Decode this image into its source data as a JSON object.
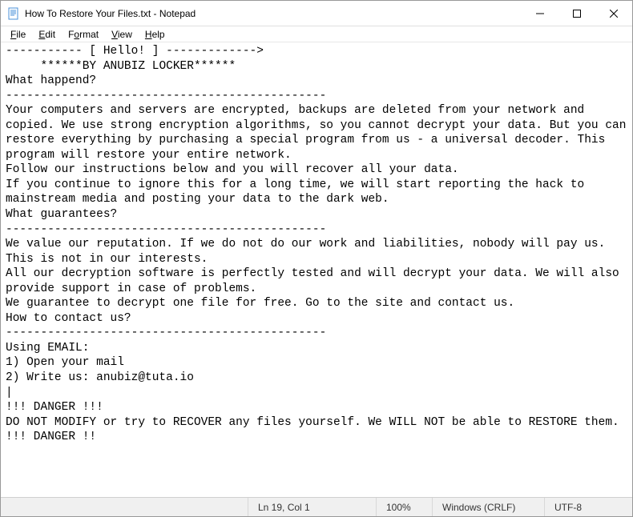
{
  "titlebar": {
    "title": "How To Restore Your Files.txt - Notepad",
    "icon_name": "notepad-icon"
  },
  "window_controls": {
    "minimize": "minimize",
    "maximize": "maximize",
    "close": "close"
  },
  "menubar": {
    "items": [
      "File",
      "Edit",
      "Format",
      "View",
      "Help"
    ]
  },
  "content": {
    "text": "----------- [ Hello! ] ------------->\n     ******BY ANUBIZ LOCKER******\nWhat happend?\n----------------------------------------------\nYour computers and servers are encrypted, backups are deleted from your network and copied. We use strong encryption algorithms, so you cannot decrypt your data. But you can restore everything by purchasing a special program from us - a universal decoder. This program will restore your entire network.\nFollow our instructions below and you will recover all your data.\nIf you continue to ignore this for a long time, we will start reporting the hack to mainstream media and posting your data to the dark web.\nWhat guarantees?\n----------------------------------------------\nWe value our reputation. If we do not do our work and liabilities, nobody will pay us. This is not in our interests.\nAll our decryption software is perfectly tested and will decrypt your data. We will also provide support in case of problems.\nWe guarantee to decrypt one file for free. Go to the site and contact us.\nHow to contact us?\n----------------------------------------------\nUsing EMAIL:\n1) Open your mail\n2) Write us: anubiz@tuta.io\n|\n!!! DANGER !!!\nDO NOT MODIFY or try to RECOVER any files yourself. We WILL NOT be able to RESTORE them.\n!!! DANGER !!"
  },
  "statusbar": {
    "position": "Ln 19, Col 1",
    "zoom": "100%",
    "line_ending": "Windows (CRLF)",
    "encoding": "UTF-8"
  }
}
